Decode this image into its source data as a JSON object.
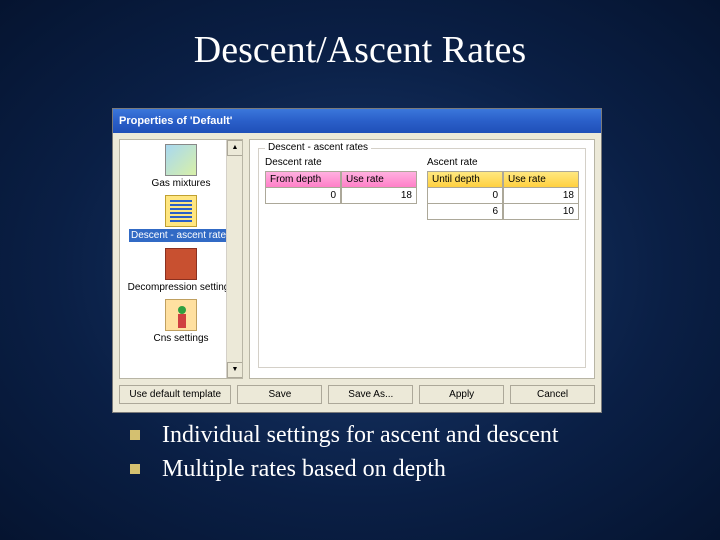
{
  "slide": {
    "title": "Descent/Ascent Rates",
    "bullets": [
      "Individual settings for ascent and descent",
      "Multiple rates based on depth"
    ]
  },
  "dialog": {
    "title": "Properties of 'Default'",
    "sidebar": {
      "items": [
        {
          "label": "Gas mixtures"
        },
        {
          "label": "Descent - ascent rates"
        },
        {
          "label": "Decompression settings"
        },
        {
          "label": "Cns settings"
        }
      ],
      "selected_index": 1
    },
    "panel": {
      "group_legend": "Descent - ascent rates",
      "descent": {
        "caption": "Descent rate",
        "col1": "From depth",
        "col2": "Use rate",
        "rows": [
          {
            "c1": "0",
            "c2": "18"
          }
        ]
      },
      "ascent": {
        "caption": "Ascent rate",
        "col1": "Until depth",
        "col2": "Use rate",
        "rows": [
          {
            "c1": "0",
            "c2": "18"
          },
          {
            "c1": "6",
            "c2": "10"
          }
        ]
      }
    },
    "buttons": {
      "use_default": "Use default template",
      "save": "Save",
      "save_as": "Save As...",
      "apply": "Apply",
      "cancel": "Cancel"
    }
  }
}
